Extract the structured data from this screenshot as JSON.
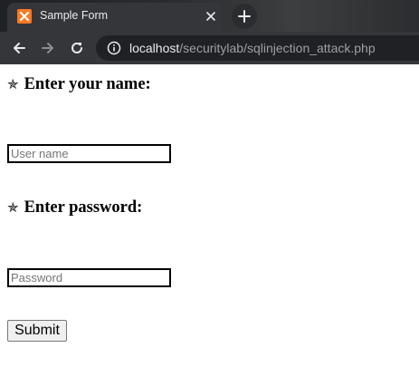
{
  "browser": {
    "tab_title": "Sample Form",
    "close_glyph": "✕",
    "new_tab_glyph": "+",
    "url_host": "localhost",
    "url_path": "/securitylab/sqlinjection_attack.php",
    "favicon_icon": "xampp-icon",
    "favicon_color": "#fb7a24"
  },
  "form": {
    "name_heading": "Enter your name:",
    "name_placeholder": "User name",
    "name_value": "",
    "password_heading": "Enter password:",
    "password_placeholder": "Password",
    "password_value": "",
    "heading_icon": "star-icon",
    "star_glyph": "✯",
    "submit_label": "Submit"
  }
}
